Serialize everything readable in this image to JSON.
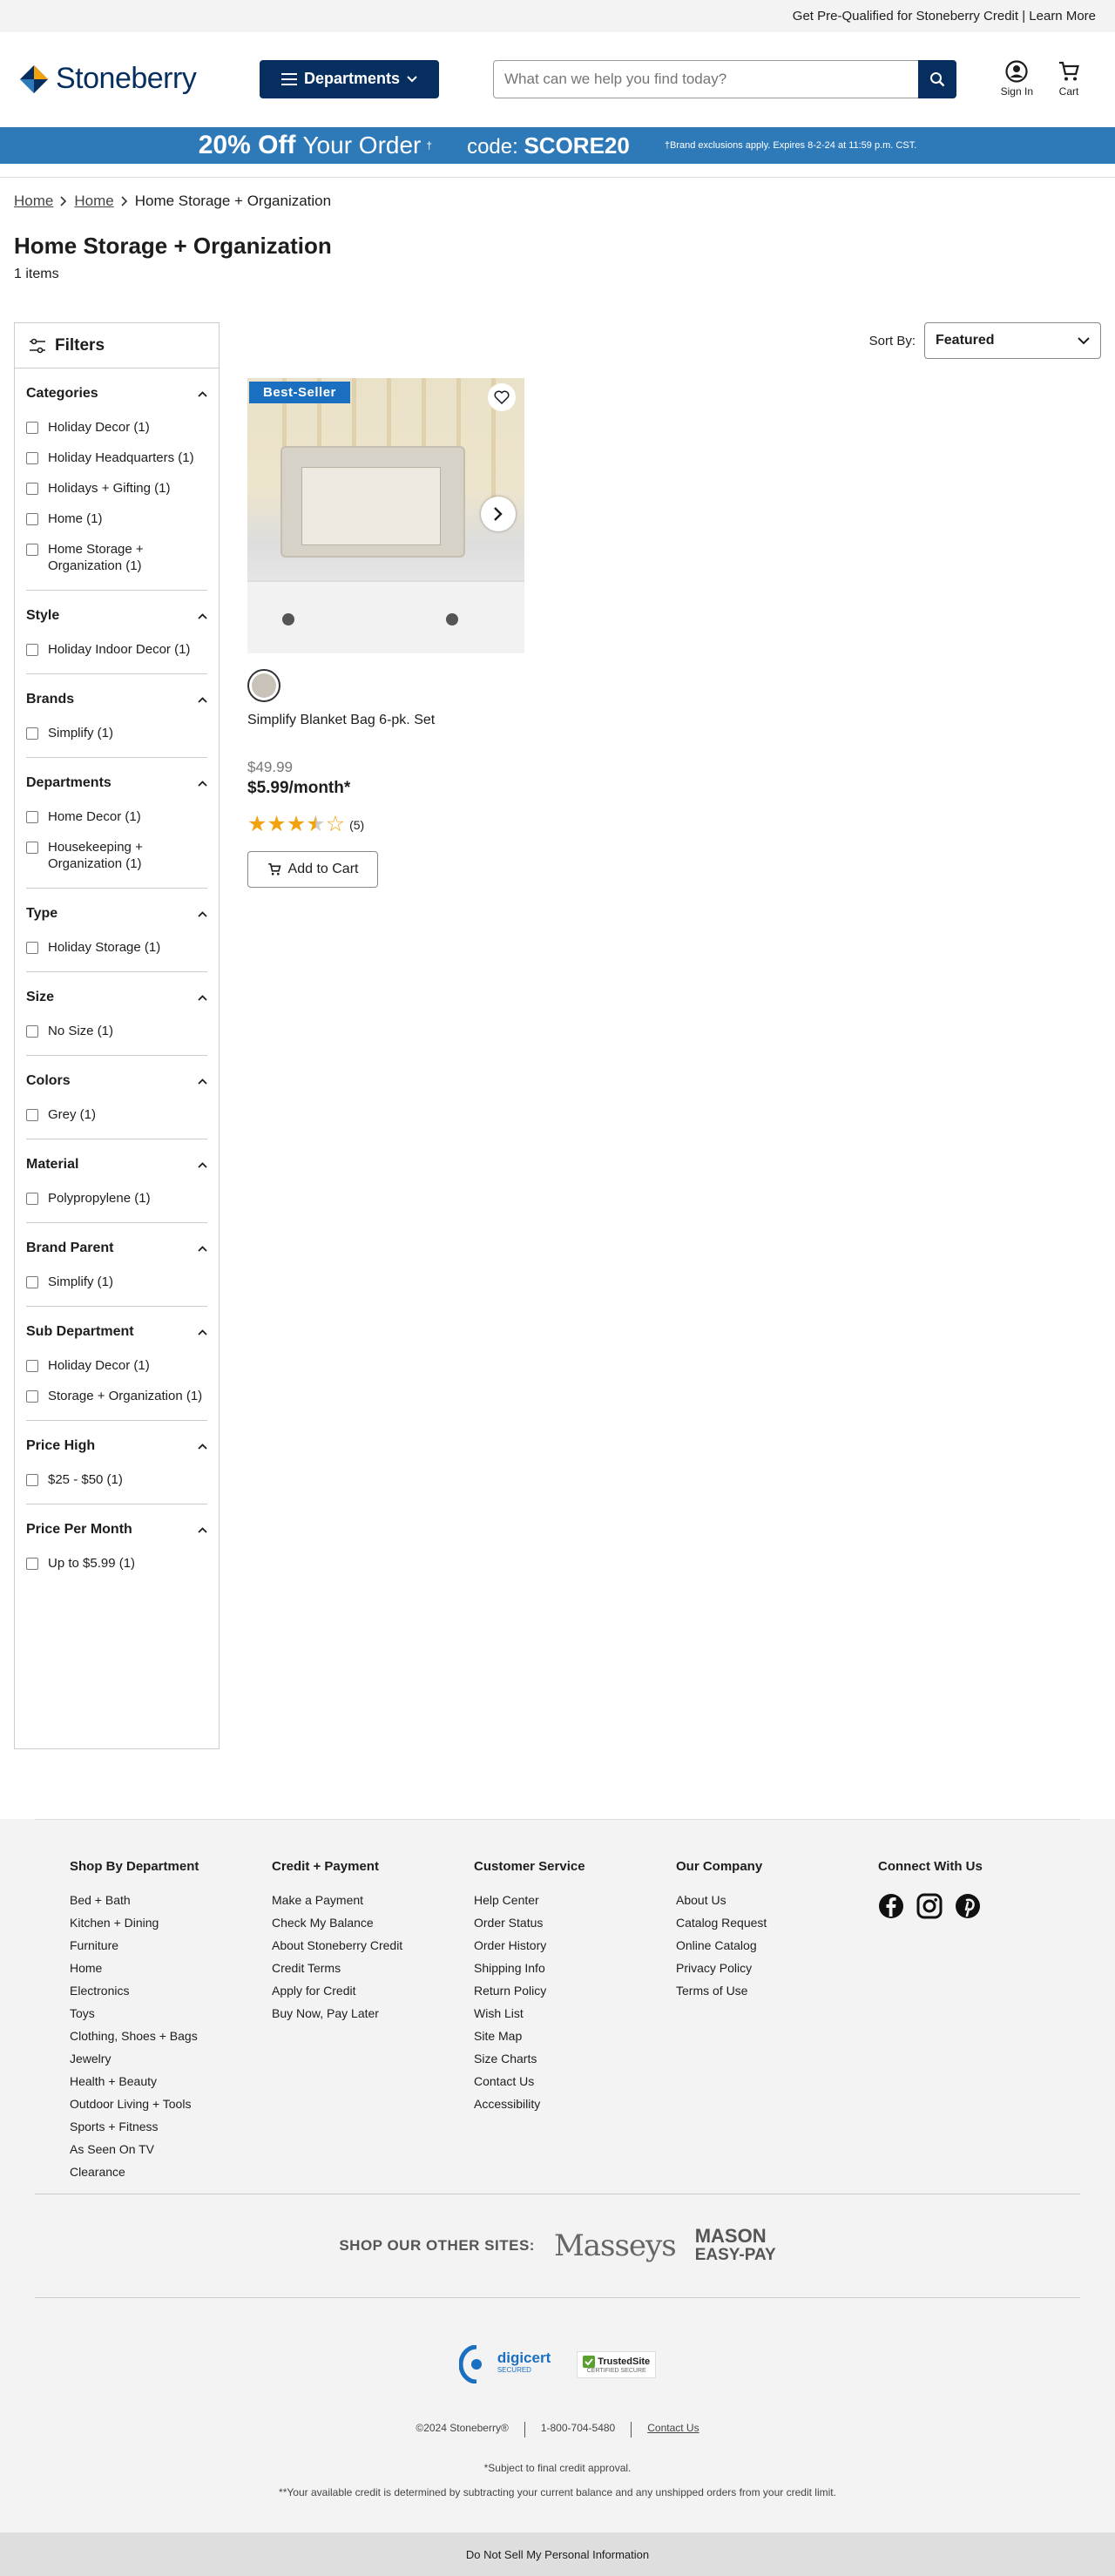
{
  "topbar": {
    "text": "Get Pre-Qualified for Stoneberry Credit | Learn More"
  },
  "header": {
    "logo_text": "Stoneberry",
    "departments_label": "Departments",
    "search_placeholder": "What can we help you find today?",
    "signin_label": "Sign In",
    "cart_label": "Cart"
  },
  "promo": {
    "big": "20% Off",
    "mid": "Your Order",
    "sup": "†",
    "code_label": "code:",
    "code": "SCORE20",
    "fine": "†Brand exclusions apply. Expires 8-2-24 at 11:59 p.m. CST."
  },
  "breadcrumbs": [
    "Home",
    "Home",
    "Home Storage + Organization"
  ],
  "page": {
    "title": "Home Storage + Organization",
    "count": "1 items"
  },
  "filters": {
    "title": "Filters",
    "sections": [
      {
        "title": "Categories",
        "options": [
          "Holiday Decor (1)",
          "Holiday Headquarters (1)",
          "Holidays + Gifting (1)",
          "Home (1)",
          "Home Storage + Organization (1)"
        ]
      },
      {
        "title": "Style",
        "options": [
          "Holiday Indoor Decor (1)"
        ]
      },
      {
        "title": "Brands",
        "options": [
          "Simplify (1)"
        ]
      },
      {
        "title": "Departments",
        "options": [
          "Home Decor (1)",
          "Housekeeping + Organization (1)"
        ]
      },
      {
        "title": "Type",
        "options": [
          "Holiday Storage (1)"
        ]
      },
      {
        "title": "Size",
        "options": [
          "No Size (1)"
        ]
      },
      {
        "title": "Colors",
        "options": [
          "Grey (1)"
        ]
      },
      {
        "title": "Material",
        "options": [
          "Polypropylene (1)"
        ]
      },
      {
        "title": "Brand Parent",
        "options": [
          "Simplify (1)"
        ]
      },
      {
        "title": "Sub Department",
        "options": [
          "Holiday Decor (1)",
          "Storage + Organization (1)"
        ]
      },
      {
        "title": "Price High",
        "options": [
          "$25 - $50 (1)"
        ]
      },
      {
        "title": "Price Per Month",
        "options": [
          "Up to $5.99 (1)"
        ]
      }
    ]
  },
  "sort": {
    "label": "Sort By:",
    "value": "Featured"
  },
  "product": {
    "badge": "Best-Seller",
    "name": "Simplify Blanket Bag 6-pk. Set",
    "old_price": "$49.99",
    "price": "$5.99/month*",
    "rating": 3.5,
    "review_count": "(5)",
    "add_to_cart": "Add to Cart",
    "star_color": "#f2a20c"
  },
  "footer": {
    "columns": [
      {
        "title": "Shop By Department",
        "links": [
          "Bed + Bath",
          "Kitchen + Dining",
          "Furniture",
          "Home",
          "Electronics",
          "Toys",
          "Clothing, Shoes + Bags",
          "Jewelry",
          "Health + Beauty",
          "Outdoor Living + Tools",
          "Sports + Fitness",
          "As Seen On TV",
          "Clearance"
        ]
      },
      {
        "title": "Credit + Payment",
        "links": [
          "Make a Payment",
          "Check My Balance",
          "About Stoneberry Credit",
          "Credit Terms",
          "Apply for Credit",
          "Buy Now, Pay Later"
        ]
      },
      {
        "title": "Customer Service",
        "links": [
          "Help Center",
          "Order Status",
          "Order History",
          "Shipping Info",
          "Return Policy",
          "Wish List",
          "Site Map",
          "Size Charts",
          "Contact Us",
          "Accessibility"
        ]
      },
      {
        "title": "Our Company",
        "links": [
          "About Us",
          "Catalog Request",
          "Online Catalog",
          "Privacy Policy",
          "Terms of Use"
        ]
      }
    ],
    "connect_title": "Connect With Us",
    "other_sites_label": "SHOP OUR OTHER SITES:",
    "masseys": "Masseys",
    "mason_line1": "MASON",
    "mason_line2": "EASY-PAY",
    "digicert": "digicert",
    "digicert_sub": "SECURED",
    "trustedsite": "TrustedSite",
    "trustedsite_sub": "CERTIFIED SECURE",
    "copyright": "©2024 Stoneberry®",
    "phone": "1-800-704-5480",
    "contact": "Contact Us",
    "note1": "*Subject to final credit approval.",
    "note2": "**Your available credit is determined by subtracting your current balance and any unshipped orders from your credit limit.",
    "dns": "Do Not Sell My Personal Information"
  }
}
